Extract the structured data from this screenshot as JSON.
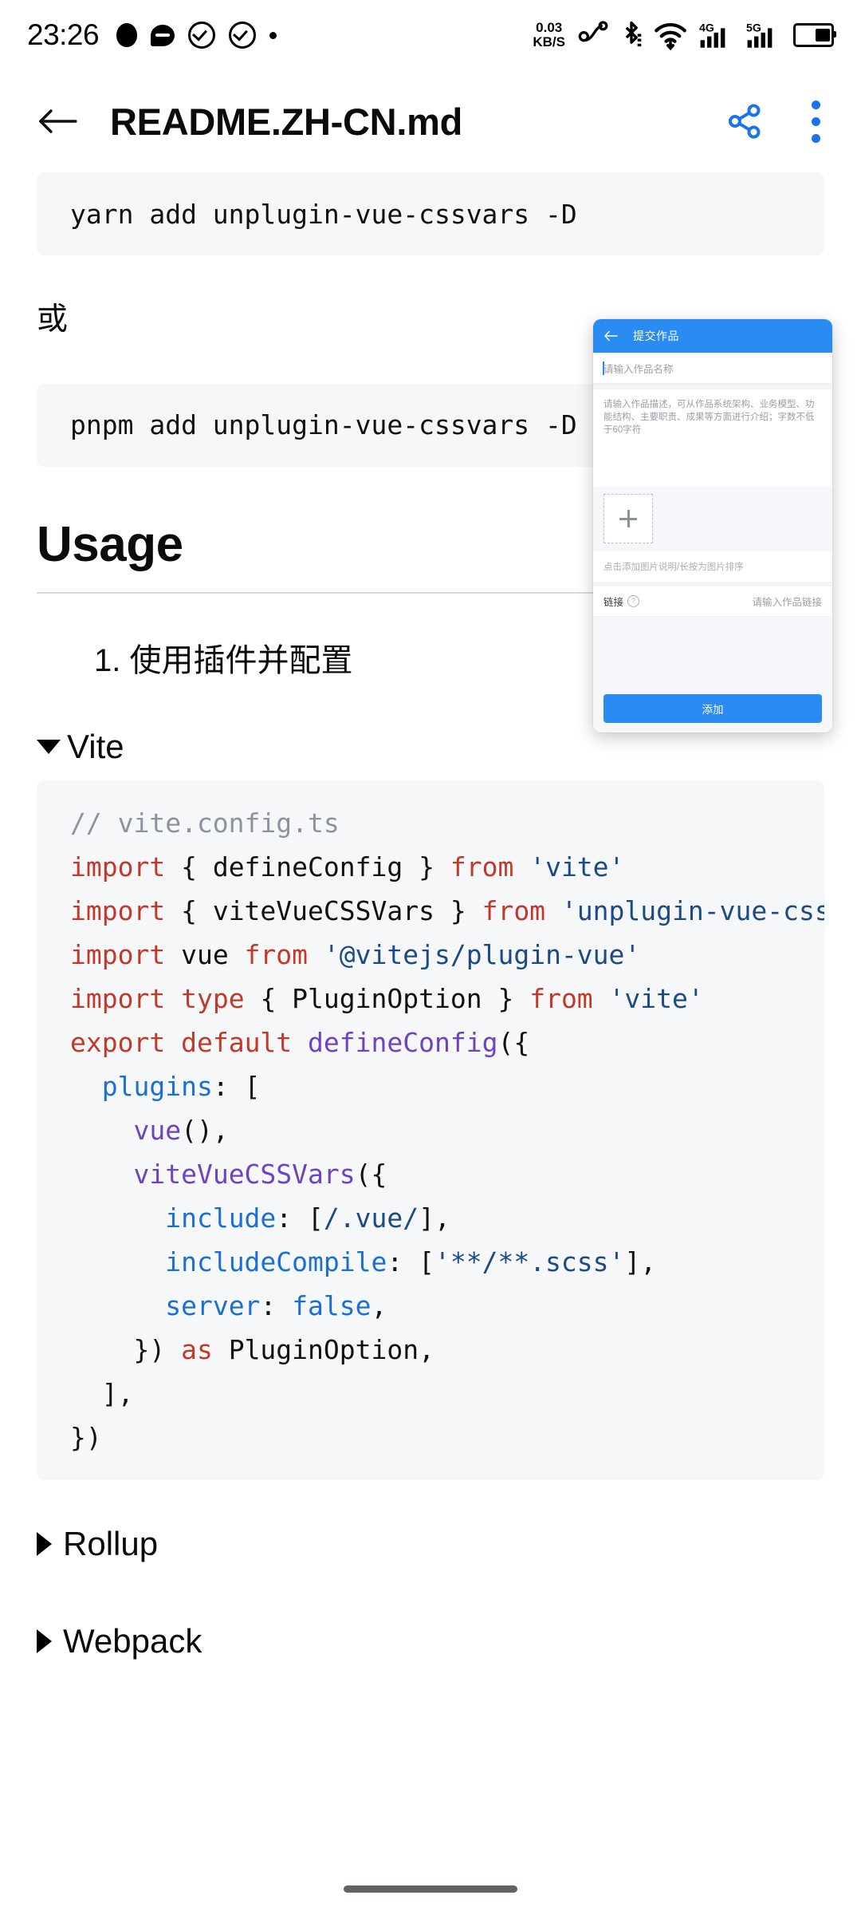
{
  "statusbar": {
    "time": "23:26",
    "left_icons": [
      "blob-icon",
      "chat-bubble-icon",
      "check-circle-icon",
      "check-circle-icon",
      "dot-icon"
    ],
    "network_speed": "0.03",
    "network_speed_unit": "KB/S",
    "right_icons": [
      "headphones-icon",
      "bluetooth-icon",
      "wifi-icon",
      "signal-4g-icon",
      "signal-5g-icon",
      "battery-icon"
    ],
    "signal_4g_label": "4G",
    "signal_5g_label": "5G"
  },
  "appbar": {
    "back_label": "back-arrow",
    "title": "README.ZH-CN.md",
    "share_label": "share",
    "more_label": "more-options"
  },
  "document": {
    "shell_yarn": "yarn add unplugin-vue-cssvars -D",
    "or_text": "或",
    "shell_pnpm": "pnpm add unplugin-vue-cssvars -D",
    "usage_heading": "Usage",
    "list_item_1": "1. 使用插件并配置",
    "vite_summary": "Vite",
    "rollup_summary": "Rollup",
    "webpack_summary": "Webpack",
    "code_vite": [
      [
        {
          "t": "// vite.config.ts",
          "c": "com"
        }
      ],
      [
        {
          "t": "import",
          "c": "key"
        },
        {
          "t": " { defineConfig } ",
          "c": "pln"
        },
        {
          "t": "from",
          "c": "key"
        },
        {
          "t": " ",
          "c": "pln"
        },
        {
          "t": "'vite'",
          "c": "str"
        }
      ],
      [
        {
          "t": "import",
          "c": "key"
        },
        {
          "t": " { viteVueCSSVars } ",
          "c": "pln"
        },
        {
          "t": "from",
          "c": "key"
        },
        {
          "t": " ",
          "c": "pln"
        },
        {
          "t": "'unplugin-vue-cssvars'",
          "c": "str"
        }
      ],
      [
        {
          "t": "import",
          "c": "key"
        },
        {
          "t": " vue ",
          "c": "pln"
        },
        {
          "t": "from",
          "c": "key"
        },
        {
          "t": " ",
          "c": "pln"
        },
        {
          "t": "'@vitejs/plugin-vue'",
          "c": "str"
        }
      ],
      [
        {
          "t": "import",
          "c": "key"
        },
        {
          "t": " ",
          "c": "pln"
        },
        {
          "t": "type",
          "c": "key"
        },
        {
          "t": " { PluginOption } ",
          "c": "pln"
        },
        {
          "t": "from",
          "c": "key"
        },
        {
          "t": " ",
          "c": "pln"
        },
        {
          "t": "'vite'",
          "c": "str"
        }
      ],
      [
        {
          "t": "export",
          "c": "key"
        },
        {
          "t": " ",
          "c": "pln"
        },
        {
          "t": "default",
          "c": "key"
        },
        {
          "t": " ",
          "c": "pln"
        },
        {
          "t": "defineConfig",
          "c": "fn"
        },
        {
          "t": "({",
          "c": "pln"
        }
      ],
      [
        {
          "t": "  ",
          "c": "pln"
        },
        {
          "t": "plugins",
          "c": "prop"
        },
        {
          "t": ": [",
          "c": "pln"
        }
      ],
      [
        {
          "t": "    ",
          "c": "pln"
        },
        {
          "t": "vue",
          "c": "fn"
        },
        {
          "t": "(),",
          "c": "pln"
        }
      ],
      [
        {
          "t": "    ",
          "c": "pln"
        },
        {
          "t": "viteVueCSSVars",
          "c": "fn"
        },
        {
          "t": "({",
          "c": "pln"
        }
      ],
      [
        {
          "t": "      ",
          "c": "pln"
        },
        {
          "t": "include",
          "c": "prop"
        },
        {
          "t": ": [",
          "c": "pln"
        },
        {
          "t": "/.vue/",
          "c": "str"
        },
        {
          "t": "],",
          "c": "pln"
        }
      ],
      [
        {
          "t": "      ",
          "c": "pln"
        },
        {
          "t": "includeCompile",
          "c": "prop"
        },
        {
          "t": ": [",
          "c": "pln"
        },
        {
          "t": "'**/**.scss'",
          "c": "str"
        },
        {
          "t": "],",
          "c": "pln"
        }
      ],
      [
        {
          "t": "      ",
          "c": "pln"
        },
        {
          "t": "server",
          "c": "prop"
        },
        {
          "t": ": ",
          "c": "pln"
        },
        {
          "t": "false",
          "c": "prop"
        },
        {
          "t": ",",
          "c": "pln"
        }
      ],
      [
        {
          "t": "    }) ",
          "c": "pln"
        },
        {
          "t": "as",
          "c": "key"
        },
        {
          "t": " PluginOption,",
          "c": "pln"
        }
      ],
      [
        {
          "t": "  ],",
          "c": "pln"
        }
      ],
      [
        {
          "t": "})",
          "c": "pln"
        }
      ]
    ]
  },
  "overlay": {
    "title": "提交作品",
    "back_label": "back-arrow",
    "name_placeholder": "请输入作品名称",
    "desc_placeholder": "请输入作品描述，可从作品系统架构、业务模型、功能结构、主要职责、成果等方面进行介绍；字数不低于60字符",
    "image_hint": "点击添加图片说明/长按为图片排序",
    "link_label": "链接",
    "link_help_icon": "?",
    "link_placeholder": "请输入作品链接",
    "submit_label": "添加",
    "accent_color": "#2a8bf2"
  },
  "gesture_bar": {
    "label": "home-indicator"
  }
}
